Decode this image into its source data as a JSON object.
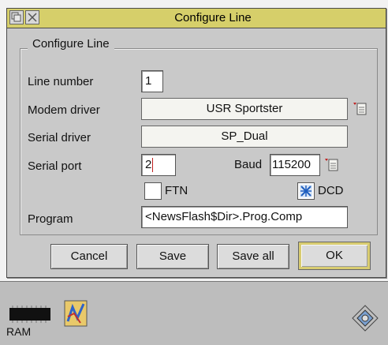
{
  "window": {
    "title": "Configure Line",
    "group_label": "Configure Line"
  },
  "fields": {
    "line_number": {
      "label": "Line number",
      "value": "1"
    },
    "modem_driver": {
      "label": "Modem driver",
      "value": "USR Sportster"
    },
    "serial_driver": {
      "label": "Serial driver",
      "value": "SP_Dual"
    },
    "serial_port": {
      "label": "Serial port",
      "value": "2"
    },
    "baud": {
      "label": "Baud",
      "value": "115200"
    },
    "ftn": {
      "label": "FTN",
      "checked": false
    },
    "dcd": {
      "label": "DCD",
      "checked": true
    },
    "program": {
      "label": "Program",
      "value": "<NewsFlash$Dir>.Prog.Comp"
    }
  },
  "buttons": {
    "cancel": "Cancel",
    "save": "Save",
    "save_all": "Save all",
    "ok": "OK"
  },
  "iconbar": {
    "ram_label": "RAM"
  },
  "icons": [
    "back-icon",
    "close-icon",
    "menu-arrow-icon",
    "ram-disc-icon",
    "app-icon",
    "acorn-icon"
  ],
  "colors": {
    "titlebar": "#d6cf6a",
    "window_bg": "#c9c9c9",
    "default_button_border": "#d8cc70",
    "caret": "#c02020"
  }
}
